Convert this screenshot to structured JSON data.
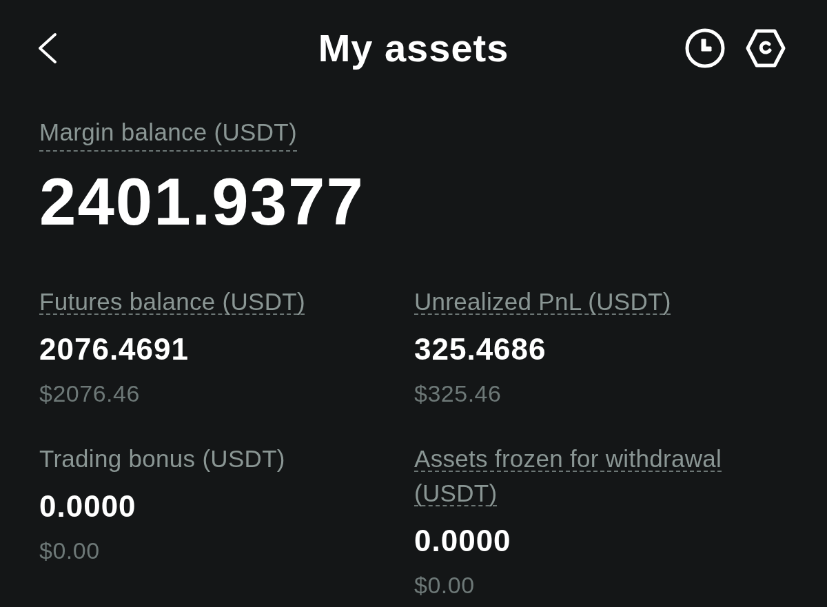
{
  "header": {
    "title": "My assets"
  },
  "margin_balance": {
    "label": "Margin balance (USDT)",
    "underlined": true,
    "value": "2401.9377"
  },
  "stats": [
    {
      "label": "Futures balance (USDT)",
      "underlined": true,
      "value": "2076.4691",
      "usd": "$2076.46"
    },
    {
      "label": "Unrealized PnL (USDT)",
      "underlined": true,
      "value": "325.4686",
      "usd": "$325.46"
    },
    {
      "label": "Trading bonus (USDT)",
      "underlined": false,
      "value": "0.0000",
      "usd": "$0.00"
    },
    {
      "label": "Assets frozen for withdrawal (USDT)",
      "underlined": true,
      "value": "0.0000",
      "usd": "$0.00"
    }
  ]
}
